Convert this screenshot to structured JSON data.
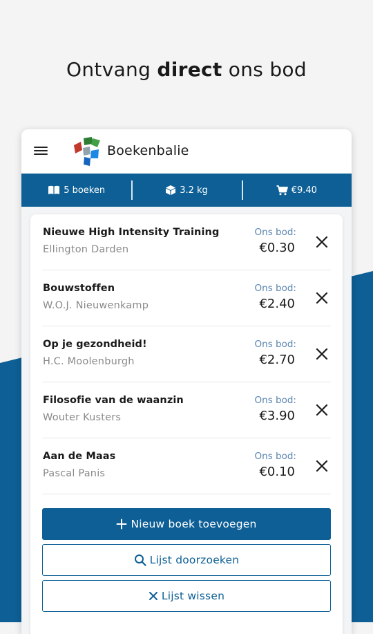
{
  "headline": {
    "pre": "Ontvang ",
    "bold": "direct",
    "post": " ons bod"
  },
  "app": {
    "title": "Boekenbalie",
    "logo_icon": "boekenbalie-logo"
  },
  "stats": {
    "books": "5 boeken",
    "books_icon": "book-icon",
    "weight": "3.2 kg",
    "weight_icon": "package-icon",
    "total": "€9.40",
    "total_icon": "cart-icon"
  },
  "books": [
    {
      "title": "Nieuwe High Intensity Training",
      "author": "Ellington Darden",
      "offer_label": "Ons bod:",
      "price": "€0.30"
    },
    {
      "title": "Bouwstoffen",
      "author": "W.O.J. Nieuwenkamp",
      "offer_label": "Ons bod:",
      "price": "€2.40"
    },
    {
      "title": "Op je gezondheid!",
      "author": "H.C. Moolenburgh",
      "offer_label": "Ons bod:",
      "price": "€2.70"
    },
    {
      "title": "Filosofie van de waanzin",
      "author": "Wouter Kusters",
      "offer_label": "Ons bod:",
      "price": "€3.90"
    },
    {
      "title": "Aan de Maas",
      "author": "Pascal Panis",
      "offer_label": "Ons bod:",
      "price": "€0.10"
    }
  ],
  "actions": {
    "add": "Nieuw boek toevoegen",
    "search": "Lijst doorzoeken",
    "clear": "Lijst wissen"
  },
  "colors": {
    "brand_blue": "#0d5f96",
    "offer_label": "#5b86b0",
    "background": "#f4f4f4"
  }
}
